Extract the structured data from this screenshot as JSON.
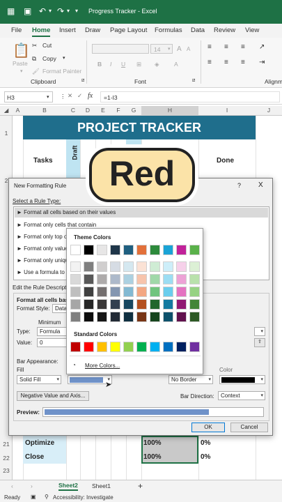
{
  "window": {
    "title": "Progress Tracker  -  Excel"
  },
  "menu": [
    "File",
    "Home",
    "Insert",
    "Draw",
    "Page Layout",
    "Formulas",
    "Data",
    "Review",
    "View"
  ],
  "ribbon": {
    "paste": "Paste",
    "cut": "Cut",
    "copy": "Copy",
    "format_painter": "Format Painter",
    "clipboard": "Clipboard",
    "font_size": "14",
    "font": "Font",
    "align": "Alignm"
  },
  "formula_bar": {
    "name_box": "H3",
    "fx": "fx",
    "formula": "=1-I3"
  },
  "columns": [
    "A",
    "B",
    "C",
    "D",
    "E",
    "F",
    "G",
    "H",
    "I",
    "J"
  ],
  "rows": [
    "1",
    "2",
    "21",
    "22",
    "23"
  ],
  "sheet": {
    "banner": "PROJECT TRACKER",
    "tasks": "Tasks",
    "draft": "Draft",
    "done": "Done",
    "row21_task": "Optimize",
    "row21_pct": "100%",
    "row21_done": "0%",
    "row22_task": "Close",
    "row22_pct": "100%",
    "row22_done": "0%"
  },
  "overlay": {
    "text": "Red"
  },
  "dialog": {
    "title": "New Formatting Rule",
    "help": "?",
    "close": "X",
    "select_label": "Select a Rule Type:",
    "rules": [
      "Format all cells based on their values",
      "Format only cells that contain",
      "Format only top o",
      "Format only values",
      "Format only uniqu",
      "Use a formula to d"
    ],
    "edit_label": "Edit the Rule Descripti",
    "format_all": "Format all cells base",
    "format_style": "Format Style:",
    "style_value": "Data",
    "minimum": "Minimum",
    "type": "Type:",
    "type_value": "Formula",
    "value": "Value:",
    "value_value": "0",
    "bar_appearance": "Bar Appearance:",
    "fill": "Fill",
    "fill_value": "Solid Fill",
    "color": "Color",
    "border_value": "No Border",
    "negative": "Negative Value and Axis...",
    "bar_direction": "Bar Direction:",
    "direction_value": "Context",
    "preview": "Preview:",
    "ok": "OK",
    "cancel": "Cancel"
  },
  "picker": {
    "theme": "Theme Colors",
    "standard": "Standard Colors",
    "more": "More Colors...",
    "theme_base": [
      "#ffffff",
      "#000000",
      "#e7e6e6",
      "#1f3649",
      "#1f5f80",
      "#e2703a",
      "#2d8a3c",
      "#1aa3d6",
      "#c1229a",
      "#5ab14a"
    ],
    "theme_shades": [
      [
        "#f2f2f2",
        "#7f7f7f",
        "#d0cece",
        "#d6dce4",
        "#d5e8f0",
        "#fbe2d5",
        "#cfecd4",
        "#cdeef9",
        "#f6d0ea",
        "#dcf0d5"
      ],
      [
        "#d9d9d9",
        "#595959",
        "#aeabab",
        "#adb9ca",
        "#acd1e1",
        "#f7c4ac",
        "#a0d8a9",
        "#9cddf3",
        "#edA2d6",
        "#b9e1ac"
      ],
      [
        "#bfbfbf",
        "#404040",
        "#757070",
        "#8496b0",
        "#83b9d2",
        "#f3a783",
        "#70c47e",
        "#6acded",
        "#e473c1",
        "#96d283"
      ],
      [
        "#a6a6a6",
        "#262626",
        "#3a3838",
        "#323f4f",
        "#174760",
        "#b4501f",
        "#22672d",
        "#137aa0",
        "#911973",
        "#438537"
      ],
      [
        "#7f7f7f",
        "#0d0d0d",
        "#161616",
        "#222a35",
        "#0f2f40",
        "#783515",
        "#16451e",
        "#0d516b",
        "#61114d",
        "#2d5925"
      ]
    ],
    "standard_colors": [
      "#c00000",
      "#ff0000",
      "#ffc000",
      "#ffff00",
      "#92d050",
      "#00b050",
      "#00b0f0",
      "#0070c0",
      "#002060",
      "#7030a0"
    ]
  },
  "tabs": {
    "sheet2": "Sheet2",
    "sheet1": "Sheet1",
    "add": "+"
  },
  "status": {
    "ready": "Ready",
    "accessibility": "Accessibility: Investigate"
  }
}
